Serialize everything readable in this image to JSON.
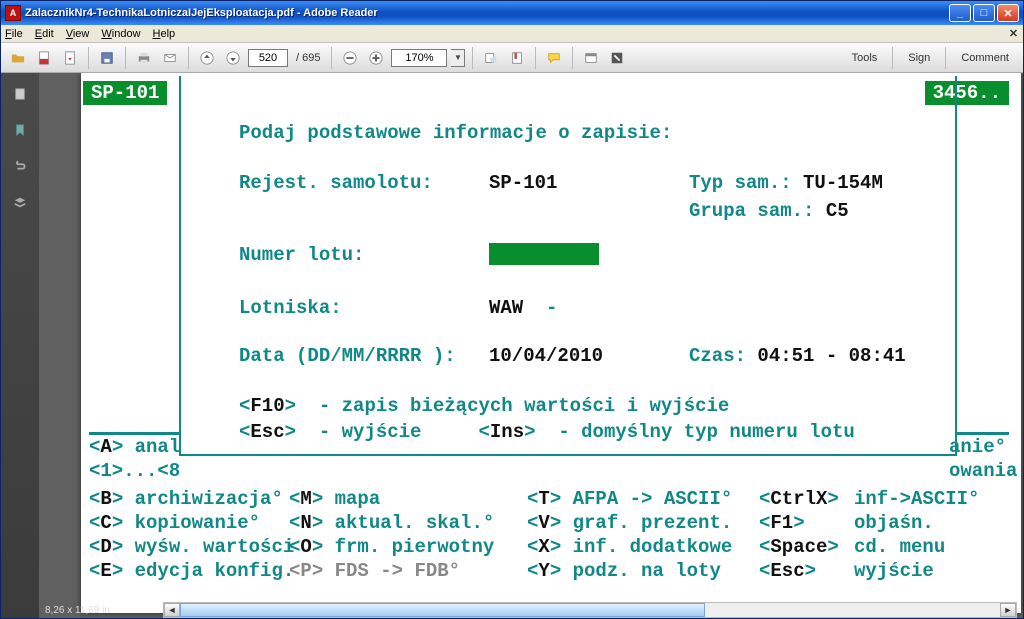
{
  "window": {
    "title": "ZalacznikNr4-TechnikaLotniczaIJejEksploatacja.pdf - Adobe Reader"
  },
  "menu": {
    "file": "File",
    "edit": "Edit",
    "view": "View",
    "window": "Window",
    "help": "Help"
  },
  "toolbar": {
    "page_current": "520",
    "page_sep": "/",
    "page_total": "695",
    "zoom": "170%",
    "tools": "Tools",
    "sign": "Sign",
    "comment": "Comment"
  },
  "status": {
    "left": "SP-101",
    "right": "3456.."
  },
  "form": {
    "heading": "Podaj podstawowe informacje o zapisie:",
    "reg_lbl": "Rejest. samolotu:",
    "reg_val": "SP-101",
    "type_lbl": "Typ sam.:",
    "type_val": "TU-154M",
    "group_lbl": "Grupa sam.:",
    "group_val": "C5",
    "flightnum_lbl": "Numer lotu:",
    "airports_lbl": "Lotniska:",
    "airports_val": "WAW",
    "airports_sep": "-",
    "date_lbl": "Data (DD/MM/RRRR ):",
    "date_val": "10/04/2010",
    "time_lbl": "Czas:",
    "time_val": "04:51 - 08:41"
  },
  "hints": {
    "f10_key": "F10",
    "f10_text": "- zapis bieżących wartości i wyjście",
    "esc_key": "Esc",
    "esc_text": "- wyjście",
    "ins_key": "Ins",
    "ins_text": "- domyślny typ numeru lotu"
  },
  "peek_left": {
    "line1_key": "A",
    "line1_text": "anal",
    "line2": "<1>...<8"
  },
  "peek_right": {
    "line1": "anie°",
    "line2": "owania"
  },
  "menu_commands": {
    "r1": {
      "c1_key": "B",
      "c1_text": "archiwizacja°",
      "c2_key": "M",
      "c2_text": "mapa",
      "c3_key": "T",
      "c3_text": "AFPA -> ASCII°",
      "c4_key": "CtrlX",
      "c5_text": "inf->ASCII°"
    },
    "r2": {
      "c1_key": "C",
      "c1_text": "kopiowanie°",
      "c2_key": "N",
      "c2_text": "aktual. skal.°",
      "c3_key": "V",
      "c3_text": "graf. prezent.",
      "c4_key": "F1",
      "c5_text": "objaśn."
    },
    "r3": {
      "c1_key": "D",
      "c1_text": "wyśw. wartości",
      "c2_key": "O",
      "c2_text": "frm. pierwotny",
      "c3_key": "X",
      "c3_text": "inf. dodatkowe",
      "c4_key": "Space",
      "c5_text": "cd. menu"
    },
    "r4": {
      "c1_key": "E",
      "c1_text": "edycja konfig.",
      "c2_key": "P",
      "c2_text": "FDS -> FDB°",
      "c3_key": "Y",
      "c3_text": "podz. na loty",
      "c4_key": "Esc",
      "c5_text": "wyjście"
    }
  },
  "footer": {
    "page_dims": "8,26 x 11,69 in"
  },
  "glyph": {
    "lt": "<",
    "gt": ">",
    "underbar": "_"
  }
}
